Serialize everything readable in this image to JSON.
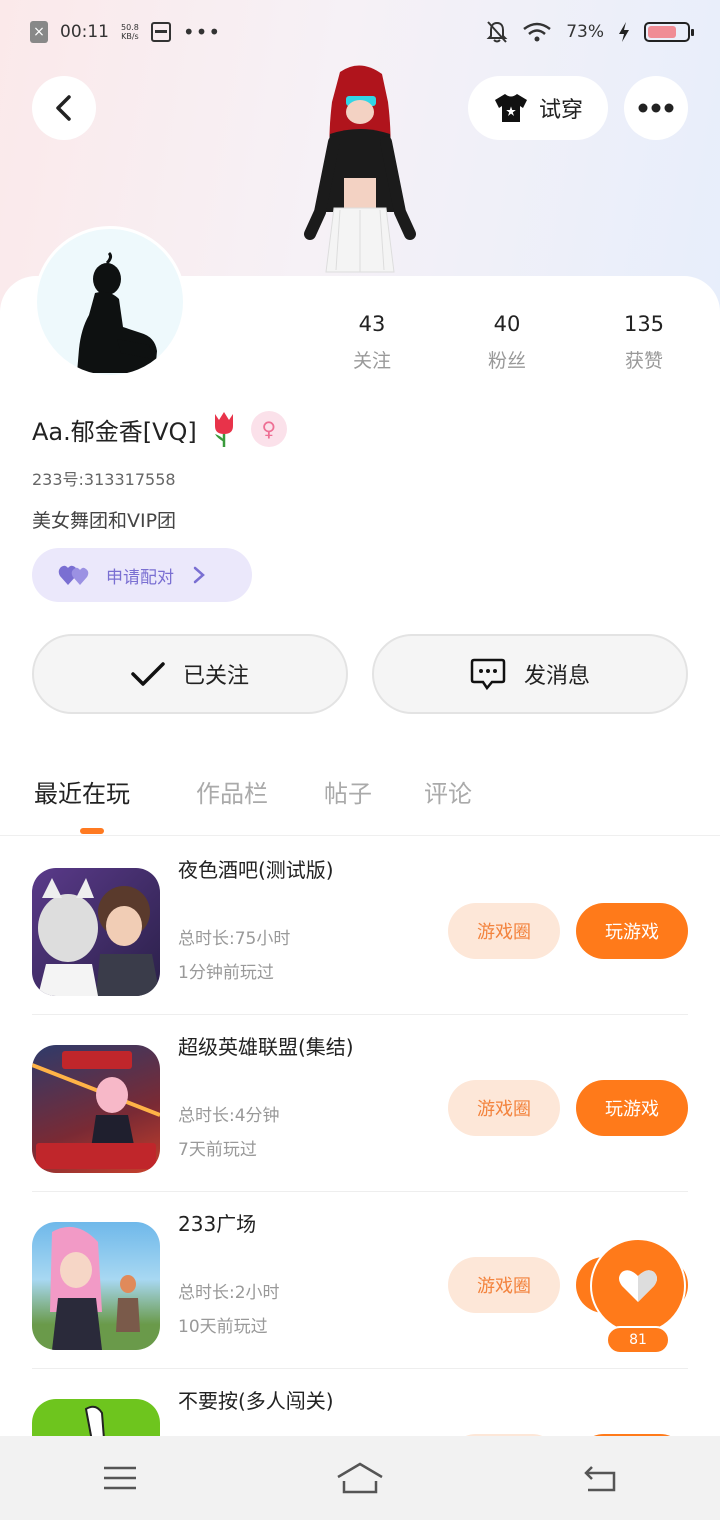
{
  "status_bar": {
    "time": "00:11",
    "speed": "50.8\nKB/s",
    "battery": "73%"
  },
  "header": {
    "tryon_label": "试穿"
  },
  "stats": [
    {
      "num": "43",
      "label": "关注"
    },
    {
      "num": "40",
      "label": "粉丝"
    },
    {
      "num": "135",
      "label": "获赞"
    }
  ],
  "profile": {
    "nickname": "Aa.郁金香[VQ]",
    "uid": "233号:313317558",
    "bio": "美女舞团和VIP团",
    "pair_label": "申请配对"
  },
  "actions": {
    "follow_label": "已关注",
    "message_label": "发消息"
  },
  "tabs": [
    "最近在玩",
    "作品栏",
    "帖子",
    "评论"
  ],
  "games": [
    {
      "title": "夜色酒吧(测试版)",
      "duration": "总时长:75小时",
      "last_played": "1分钟前玩过",
      "circle_label": "游戏圈",
      "play_label": "玩游戏"
    },
    {
      "title": "超级英雄联盟(集结)",
      "duration": "总时长:4分钟",
      "last_played": "7天前玩过",
      "circle_label": "游戏圈",
      "play_label": "玩游戏"
    },
    {
      "title": "233广场",
      "duration": "总时长:2小时",
      "last_played": "10天前玩过",
      "circle_label": "游戏圈",
      "play_label": "玩游戏"
    },
    {
      "title": "不要按(多人闯关)"
    }
  ],
  "like": {
    "count": "81"
  },
  "colors": {
    "accent": "#ff7a1a",
    "accent_light": "#fde7d8",
    "pair_bg": "#ebe8fb",
    "pair_text": "#7a6fd2"
  }
}
